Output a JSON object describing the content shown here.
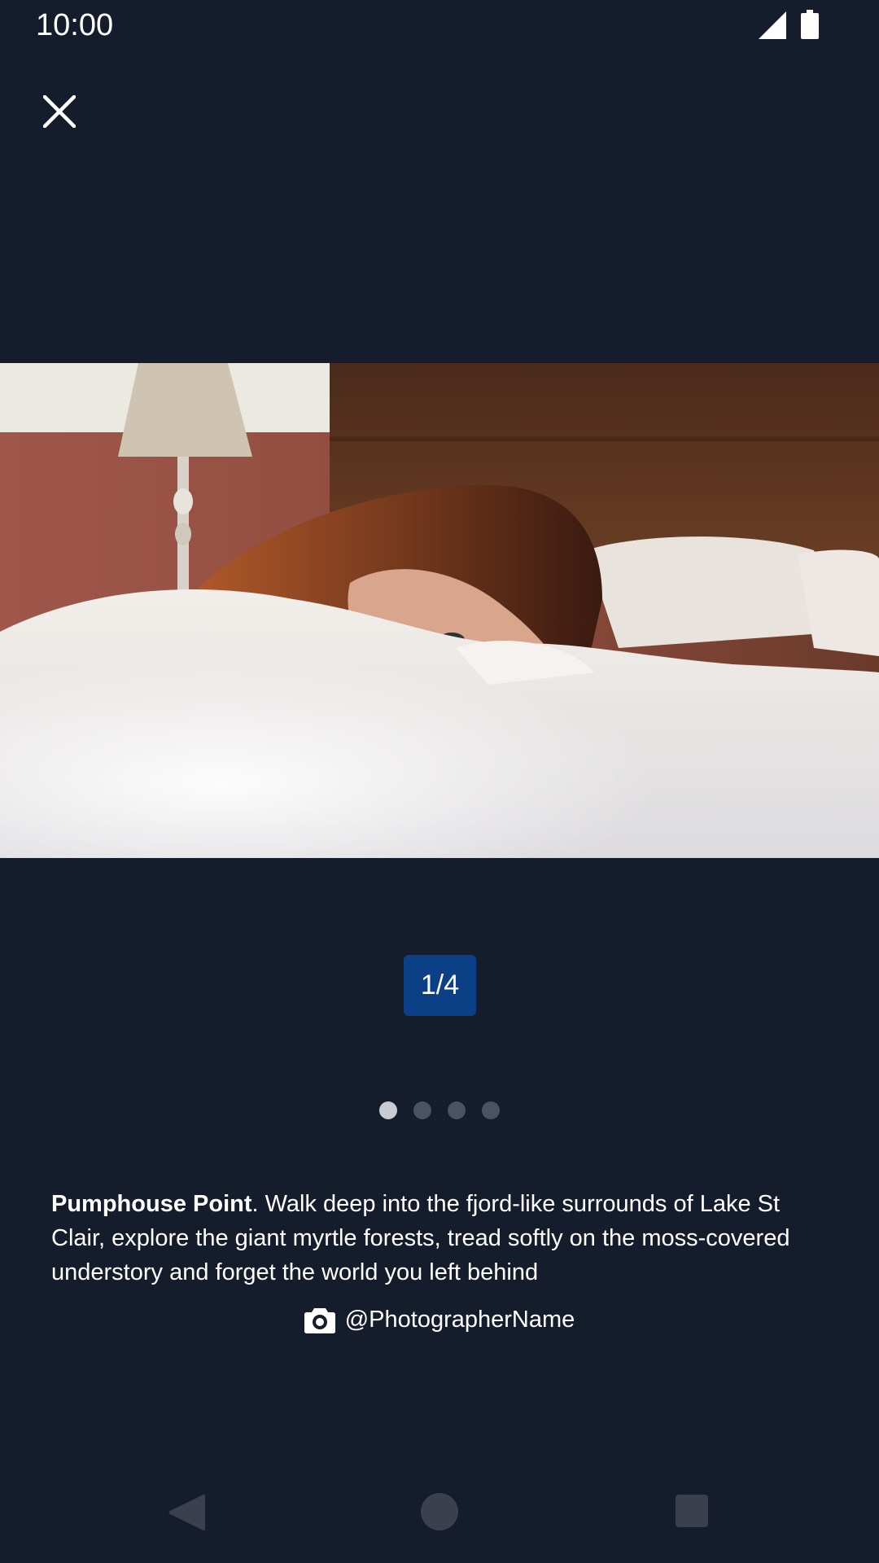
{
  "status_bar": {
    "time": "10:00",
    "icons": [
      "signal-icon",
      "battery-icon"
    ]
  },
  "toolbar": {
    "close_icon": "close-icon"
  },
  "gallery": {
    "counter": "1/4",
    "current_index": 1,
    "total": 4
  },
  "caption": {
    "title": "Pumphouse Point",
    "body": ". Walk deep into the fjord-like surrounds of Lake St Clair, explore the giant myrtle forests, tread softly on the moss-covered understory and forget the world you left behind",
    "credit_icon": "camera-icon",
    "credit": "@PhotographerName"
  },
  "nav_bar": {
    "buttons": [
      "back-icon",
      "home-icon",
      "recents-icon"
    ]
  },
  "colors": {
    "background": "#151c2b",
    "badge": "#0b3f86",
    "dot_active": "#c9ccd3",
    "dot_inactive": "#4b5263"
  }
}
